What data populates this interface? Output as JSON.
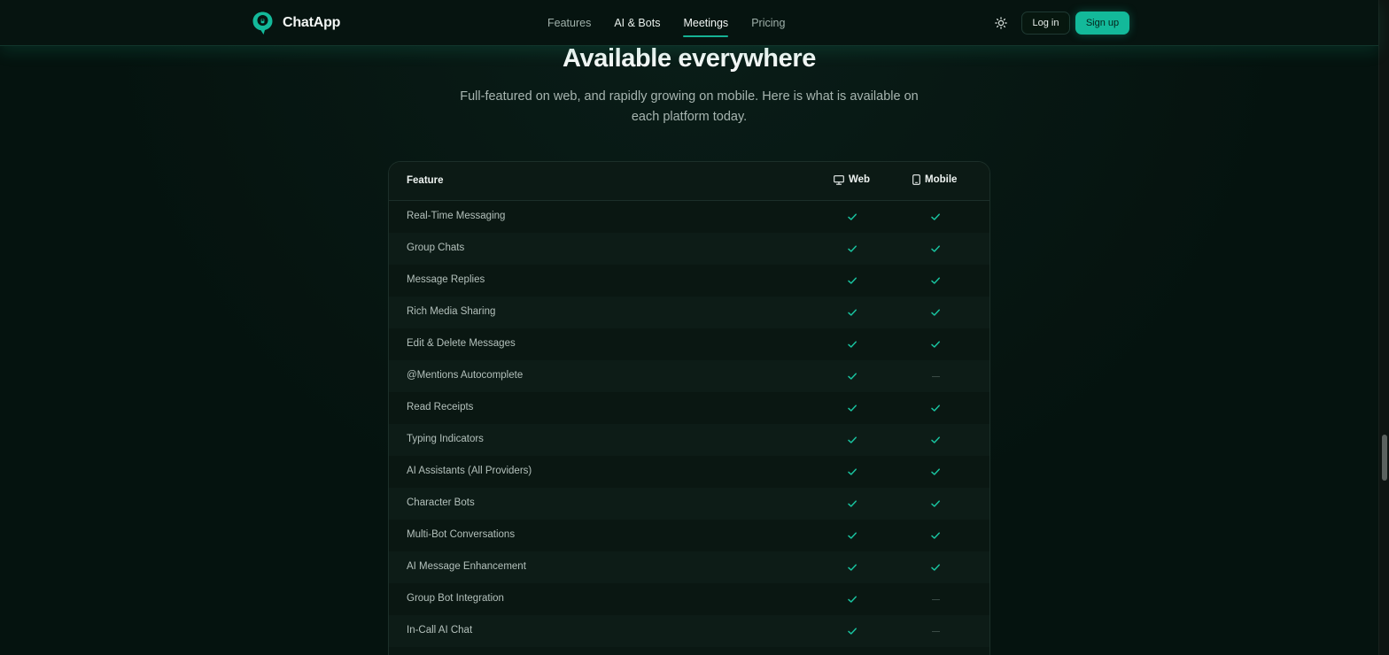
{
  "brand": {
    "name": "ChatApp",
    "accent": "#13b99a"
  },
  "nav": [
    {
      "label": "Features",
      "state": "default"
    },
    {
      "label": "AI & Bots",
      "state": "bright"
    },
    {
      "label": "Meetings",
      "state": "active"
    },
    {
      "label": "Pricing",
      "state": "default"
    }
  ],
  "header": {
    "theme_icon": "sun-icon",
    "login_label": "Log in",
    "signup_label": "Sign up"
  },
  "hero": {
    "title": "Available everywhere",
    "subtitle": "Full-featured on web, and rapidly growing on mobile. Here is what is available on each platform today."
  },
  "table": {
    "col_feature": "Feature",
    "col_web": "Web",
    "col_mobile": "Mobile",
    "web_icon": "monitor-icon",
    "mobile_icon": "smartphone-icon",
    "rows": [
      {
        "feature": "Real-Time Messaging",
        "web": true,
        "mobile": true
      },
      {
        "feature": "Group Chats",
        "web": true,
        "mobile": true
      },
      {
        "feature": "Message Replies",
        "web": true,
        "mobile": true
      },
      {
        "feature": "Rich Media Sharing",
        "web": true,
        "mobile": true
      },
      {
        "feature": "Edit & Delete Messages",
        "web": true,
        "mobile": true
      },
      {
        "feature": "@Mentions Autocomplete",
        "web": true,
        "mobile": false
      },
      {
        "feature": "Read Receipts",
        "web": true,
        "mobile": true
      },
      {
        "feature": "Typing Indicators",
        "web": true,
        "mobile": true
      },
      {
        "feature": "AI Assistants (All Providers)",
        "web": true,
        "mobile": true
      },
      {
        "feature": "Character Bots",
        "web": true,
        "mobile": true
      },
      {
        "feature": "Multi-Bot Conversations",
        "web": true,
        "mobile": true
      },
      {
        "feature": "AI Message Enhancement",
        "web": true,
        "mobile": true
      },
      {
        "feature": "Group Bot Integration",
        "web": true,
        "mobile": false
      },
      {
        "feature": "In-Call AI Chat",
        "web": true,
        "mobile": false
      }
    ]
  }
}
